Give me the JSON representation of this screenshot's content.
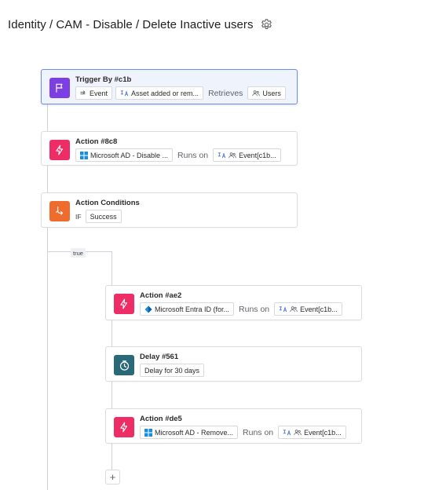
{
  "header": {
    "title": "Identity / CAM - Disable / Delete Inactive users",
    "settings_icon": "gear-icon"
  },
  "colors": {
    "trigger_icon_bg": "#7b3fe4",
    "action_icon_bg": "#ee2d67",
    "condition_icon_bg": "#ef6c2f",
    "delay_icon_bg": "#2a6a78",
    "selected_border": "#6f8fdc",
    "selected_bg": "#eef3fc",
    "connector": "#cfd3d8"
  },
  "trigger": {
    "title": "Trigger By #c1b",
    "event_label": "Event",
    "asset_label": "Asset added or rem...",
    "retrieves_label": "Retrieves",
    "users_label": "Users"
  },
  "action1": {
    "title": "Action #8c8",
    "app_label": "Microsoft AD - Disable ...",
    "runs_on_label": "Runs on",
    "target_label": "Event[c1b..."
  },
  "condition": {
    "title": "Action Conditions",
    "if_label": "IF",
    "value_label": "Success"
  },
  "branch": {
    "label": "true"
  },
  "action2": {
    "title": "Action #ae2",
    "app_label": "Microsoft Entra ID (for...",
    "runs_on_label": "Runs on",
    "target_label": "Event[c1b..."
  },
  "delay": {
    "title": "Delay #561",
    "value_label": "Delay for 30 days"
  },
  "action3": {
    "title": "Action #de5",
    "app_label": "Microsoft AD - Remove...",
    "runs_on_label": "Runs on",
    "target_label": "Event[c1b..."
  },
  "add_step": {
    "label": "+"
  }
}
